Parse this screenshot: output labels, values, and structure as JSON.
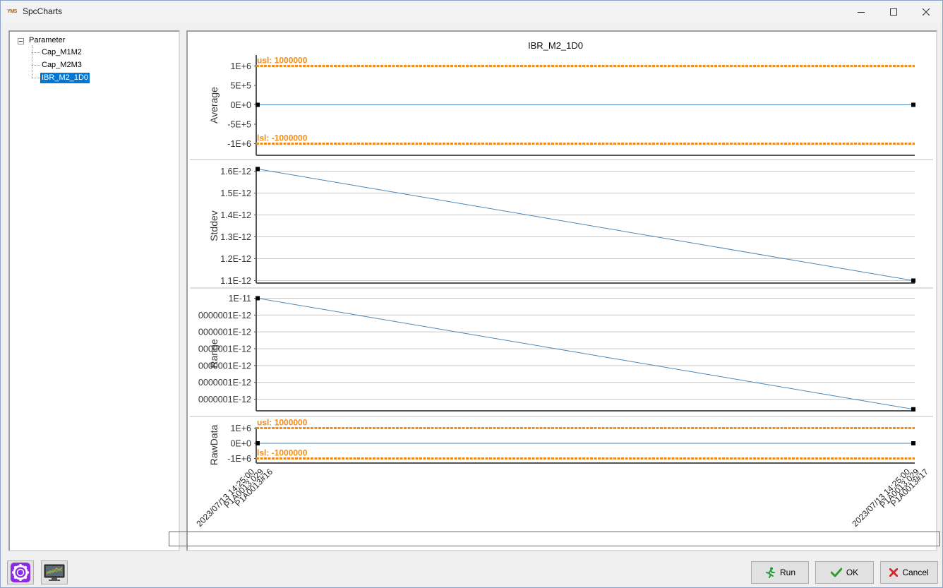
{
  "window": {
    "app_icon_text": "YMS",
    "title": "SpcCharts",
    "icons": {
      "minimize": "minimize-icon",
      "maximize": "maximize-icon",
      "close": "close-icon"
    }
  },
  "tree": {
    "root": {
      "label": "Parameter",
      "expanded": true
    },
    "items": [
      {
        "label": "Cap_M1M2",
        "selected": false
      },
      {
        "label": "Cap_M2M3",
        "selected": false
      },
      {
        "label": "IBR_M2_1D0",
        "selected": true
      }
    ]
  },
  "toolbar": {
    "settings_icon": "gear-icon",
    "chart_icon": "chart-monitor-icon",
    "run_label": "Run",
    "ok_label": "OK",
    "cancel_label": "Cancel"
  },
  "colors": {
    "accent": "#0078d7",
    "limit_line": "#f28c1c",
    "series_line": "#4a86b8",
    "highlight_box": "#e03030"
  },
  "chart_data": {
    "type": "line",
    "title": "IBR_M2_1D0",
    "x": [
      "2023/07/13 14:25:00\nP1A0013.029\nP1A0013#16",
      "2023/07/13 14:25:00\nP1A0013.029\nP1A0013#17"
    ],
    "panels": [
      {
        "ylabel": "Average",
        "ylim": [
          -1250000,
          1250000
        ],
        "yticks": [
          1000000,
          500000,
          0,
          -500000,
          -1000000
        ],
        "ytick_labels": [
          "1E+6",
          "5E+5",
          "0E+0",
          "-5E+5",
          "-1E+6"
        ],
        "grid": false,
        "series": [
          {
            "values": [
              0,
              0
            ]
          }
        ],
        "limits": [
          {
            "label": "usl: 1000000",
            "value": 1000000
          },
          {
            "label": "lsl: -1000000",
            "value": -1000000
          }
        ]
      },
      {
        "ylabel": "Stddev",
        "ylim": [
          1.07e-12,
          1.62e-12
        ],
        "yticks": [
          1.6e-12,
          1.5e-12,
          1.4e-12,
          1.3e-12,
          1.2e-12,
          1.1e-12
        ],
        "ytick_labels": [
          "1.6E-12",
          "1.5E-12",
          "1.4E-12",
          "1.3E-12",
          "1.2E-12",
          "1.1E-12"
        ],
        "grid": true,
        "series": [
          {
            "values": [
              1.61e-12,
              1.1e-12
            ]
          }
        ],
        "limits": []
      },
      {
        "ylabel": "Range",
        "ylim": [
          6.3e-12,
          1.02e-11
        ],
        "yticks": [
          1e-11,
          9.5e-12,
          9e-12,
          8.5e-12,
          8e-12,
          7.5e-12,
          7e-12
        ],
        "ytick_labels": [
          "1E-11",
          "0000001E-12",
          "0000001E-12",
          "0000001E-12",
          "0000001E-12",
          "0000001E-12",
          "0000001E-12"
        ],
        "grid": true,
        "series": [
          {
            "values": [
              1e-11,
              6.7e-12
            ]
          }
        ],
        "limits": []
      },
      {
        "ylabel": "RawData",
        "ylim": [
          -1500000,
          1500000
        ],
        "yticks": [
          1000000,
          0,
          -1000000
        ],
        "ytick_labels": [
          "1E+6",
          "0E+0",
          "-1E+6"
        ],
        "grid": false,
        "series": [
          {
            "values": [
              0,
              0
            ]
          }
        ],
        "limits": [
          {
            "label": "usl: 1000000",
            "value": 1000000
          },
          {
            "label": "lsl: -1000000",
            "value": -1000000
          }
        ]
      }
    ]
  }
}
